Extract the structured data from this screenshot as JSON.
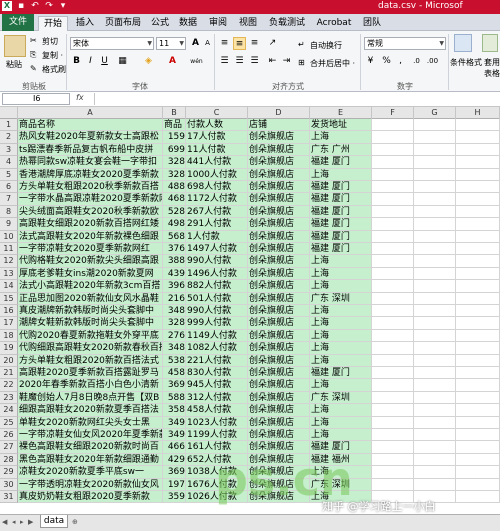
{
  "titlebar": {
    "title": "data.csv - Microsof",
    "quick_access": [
      "save-icon",
      "undo-icon",
      "redo-icon",
      "customize-icon"
    ]
  },
  "tabs": [
    "文件",
    "开始",
    "插入",
    "页面布局",
    "公式",
    "数据",
    "审阅",
    "视图",
    "负载测试",
    "Acrobat",
    "团队"
  ],
  "ribbon": {
    "clipboard": {
      "paste": "粘贴",
      "cut": "剪切",
      "copy": "复制 ·",
      "format_painter": "格式刷",
      "label": "剪贴板"
    },
    "font": {
      "name": "宋体",
      "size": "11",
      "bold": "B",
      "italic": "I",
      "underline": "U",
      "grow": "A",
      "shrink": "A",
      "wen": "wén",
      "label": "字体"
    },
    "alignment": {
      "wrap": "自动换行",
      "merge": "合并后居中 ·",
      "label": "对齐方式"
    },
    "number": {
      "format": "常规",
      "currency": "·",
      "percent": "%",
      "comma": ",",
      "label": "数字"
    },
    "styles": {
      "conditional": "条件格式",
      "table": "套用",
      "table2": "表格"
    }
  },
  "formula_bar": {
    "namebox": "I6",
    "fx": "fx"
  },
  "columns": [
    "A",
    "B",
    "C",
    "D",
    "E",
    "F",
    "G",
    "H"
  ],
  "rows": [
    [
      "商品名称",
      "商品",
      "付款人数",
      "店铺",
      "发货地址"
    ],
    [
      "热风女鞋2020年夏新款女士高跟松",
      "159",
      "17人付款",
      "创朵旗舰店",
      "上海"
    ],
    [
      "ts踢漂春季新品复古帆布船中皮拼",
      "699",
      "11人付款",
      "创朵旗舰店",
      "广东  广州"
    ],
    [
      "热幂同款sw凉鞋女宴会鞋一字带扣",
      "328",
      "441人付款",
      "创朵旗舰店",
      "福建  厦门"
    ],
    [
      "香港潮牌厚底凉鞋女2020夏季新款",
      "328",
      "1000人付款",
      "创朵旗舰店",
      "上海"
    ],
    [
      "方头单鞋女粗跟2020秋季新款百搭",
      "488",
      "698人付款",
      "创朵旗舰店",
      "福建  厦门"
    ],
    [
      "一字带水晶高跟凉鞋2020夏季新款网红",
      "468",
      "1172人付款",
      "创朵旗舰店",
      "福建  厦门"
    ],
    [
      "尖头绒面高跟鞋女2020秋季新款欧",
      "528",
      "267人付款",
      "创朵旗舰店",
      "福建  厦门"
    ],
    [
      "高跟鞋女细跟2020新款百搭网红矮",
      "498",
      "291人付款",
      "创朵旗舰店",
      "福建  厦门"
    ],
    [
      "法式高跟鞋女2020年新款裸色细跟",
      "568",
      "1人付款",
      "创朵旗舰店",
      "福建  厦门"
    ],
    [
      "一字带凉鞋女2020夏季新款网红",
      "376",
      "1497人付款",
      "创朵旗舰店",
      "福建  厦门"
    ],
    [
      "代购格鞋女2020新款尖头细跟高跟",
      "388",
      "990人付款",
      "创朵旗舰店",
      "上海"
    ],
    [
      "厚底老爹鞋女ins潮2020新款夏网",
      "439",
      "1496人付款",
      "创朵旗舰店",
      "上海"
    ],
    [
      "法式小高跟鞋2020年新款3cm百搭",
      "396",
      "882人付款",
      "创朵旗舰店",
      "上海"
    ],
    [
      "正品思加图2020新款仙女风水晶鞋",
      "216",
      "501人付款",
      "创朵旗舰店",
      "广东  深圳"
    ],
    [
      "真皮潮牌新款韩版时尚尖头套脚中",
      "348",
      "990人付款",
      "创朵旗舰店",
      "上海"
    ],
    [
      "潮牌女鞋新款韩版时尚尖头套脚中",
      "328",
      "999人付款",
      "创朵旗舰店",
      "上海"
    ],
    [
      "代购2020春夏新款拖鞋女外穿平底",
      "276",
      "1149人付款",
      "创朵旗舰店",
      "上海"
    ],
    [
      "代购细跟高跟鞋女2020新款春秋百搭",
      "348",
      "1082人付款",
      "创朵旗舰店",
      "上海"
    ],
    [
      "方头单鞋女粗跟2020新款百搭法式",
      "538",
      "221人付款",
      "创朵旗舰店",
      "上海"
    ],
    [
      "高跟鞋2020夏季新款百搭露趾罗马",
      "458",
      "830人付款",
      "创朵旗舰店",
      "福建  厦门"
    ],
    [
      "2020年春季新款百搭小白色小清新",
      "369",
      "945人付款",
      "创朵旗舰店",
      "上海"
    ],
    [
      "鞋魔创始人7月8日晚8点开售【双B",
      "588",
      "312人付款",
      "创朵旗舰店",
      "广东  深圳"
    ],
    [
      "细跟高跟鞋女2020新款夏季百搭法",
      "358",
      "458人付款",
      "创朵旗舰店",
      "上海"
    ],
    [
      "单鞋女2020新款网红尖头女士黑",
      "349",
      "1023人付款",
      "创朵旗舰店",
      "上海"
    ],
    [
      "一字带凉鞋女仙女风2020年夏季新款",
      "349",
      "1199人付款",
      "创朵旗舰店",
      "上海"
    ],
    [
      "裸色高跟鞋女细跟2020新款时尚百",
      "466",
      "161人付款",
      "创朵旗舰店",
      "福建  厦门"
    ],
    [
      "黑色高跟鞋女2020年新款细跟通勤",
      "429",
      "652人付款",
      "创朵旗舰店",
      "福建  福州"
    ],
    [
      "凉鞋女2020新款夏季平底sw一",
      "369",
      "1038人付款",
      "创朵旗舰店",
      "上海"
    ],
    [
      "一字带透明凉鞋女2020新款仙女风",
      "197",
      "1676人付款",
      "创朵旗舰店",
      "广东  深圳"
    ],
    [
      "真皮奶奶鞋女粗跟2020夏季新款",
      "359",
      "1026人付款",
      "创朵旗舰店",
      "上海"
    ]
  ],
  "sheet": {
    "name": "data"
  },
  "watermark": "知乎 @学习路上一小白",
  "big_watermark": "ps.cn"
}
